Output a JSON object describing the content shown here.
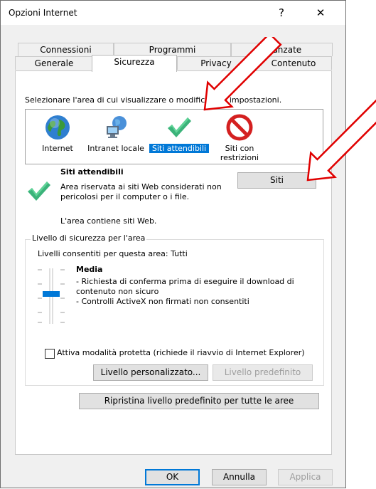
{
  "window": {
    "title": "Opzioni Internet",
    "help": "?",
    "close": "✕"
  },
  "tabs_top": [
    "Connessioni",
    "Programmi",
    "Avanzate"
  ],
  "tabs_bottom": [
    "Generale",
    "Sicurezza",
    "Privacy",
    "Contenuto"
  ],
  "zone_instruction": "Selezionare l'area di cui visualizzare o modificare le impostazioni.",
  "zones": [
    {
      "label": "Internet",
      "icon": "globe-icon"
    },
    {
      "label": "Intranet locale",
      "icon": "network-icon"
    },
    {
      "label": "Siti attendibili",
      "icon": "checkmark-icon",
      "selected": true
    },
    {
      "label": "Siti con\nrestrizioni",
      "icon": "prohibited-icon"
    }
  ],
  "zone_info": {
    "title": "Siti attendibili",
    "description": "Area riservata ai siti Web considerati non pericolosi per il computer o i file.",
    "contains": "L'area contiene siti Web.",
    "sites_button": "Siti"
  },
  "security": {
    "group_label": "Livello di sicurezza per l'area",
    "allowed": "Livelli consentiti per questa area: Tutti",
    "level_name": "Media",
    "bullets": [
      "- Richiesta di conferma prima di eseguire il download di contenuto non sicuro",
      "- Controlli ActiveX non firmati non consentiti"
    ],
    "slider_level": "Media",
    "protected_mode": "Attiva modalità protetta (richiede il riavvio di Internet Explorer)",
    "custom_button": "Livello personalizzato...",
    "default_button": "Livello predefinito"
  },
  "reset_all": "Ripristina livello predefinito per tutte le aree",
  "footer": {
    "ok": "OK",
    "cancel": "Annulla",
    "apply": "Applica"
  },
  "colors": {
    "selection": "#0078d7",
    "annotation_arrow": "#e00000"
  }
}
